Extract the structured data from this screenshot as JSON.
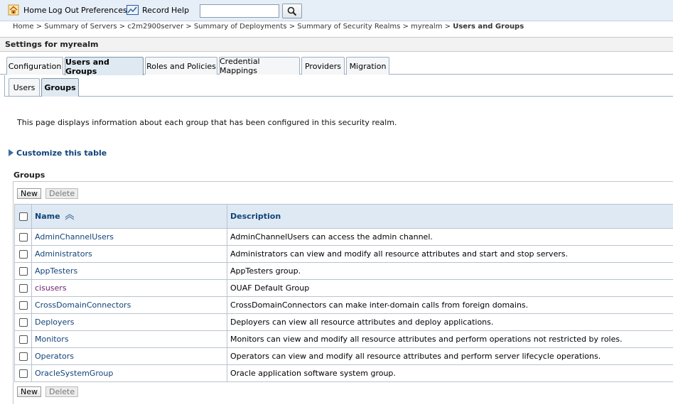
{
  "toolbar": {
    "home": "Home",
    "logout": "Log Out",
    "preferences": "Preferences",
    "record": "Record",
    "help": "Help",
    "search_value": ""
  },
  "breadcrumb": {
    "items": [
      "Home >",
      "Summary of Servers >",
      "c2m2900server >",
      "Summary of Deployments >",
      "Summary of Security Realms >",
      "myrealm >"
    ],
    "current": "Users and Groups"
  },
  "settings": {
    "title": "Settings for myrealm"
  },
  "tabs": [
    "Configuration",
    "Users and Groups",
    "Roles and Policies",
    "Credential Mappings",
    "Providers",
    "Migration"
  ],
  "subtabs": [
    "Users",
    "Groups"
  ],
  "intro": "This page displays information about each group that has been configured in this security realm.",
  "customize": "Customize this table",
  "groups_label": "Groups",
  "buttons": {
    "new": "New",
    "delete": "Delete"
  },
  "table": {
    "columns": {
      "name": "Name",
      "description": "Description"
    },
    "rows": [
      {
        "name": "AdminChannelUsers",
        "description": "AdminChannelUsers can access the admin channel."
      },
      {
        "name": "Administrators",
        "description": "Administrators can view and modify all resource attributes and start and stop servers."
      },
      {
        "name": "AppTesters",
        "description": "AppTesters group."
      },
      {
        "name": "cisusers",
        "description": "OUAF Default Group"
      },
      {
        "name": "CrossDomainConnectors",
        "description": "CrossDomainConnectors can make inter-domain calls from foreign domains."
      },
      {
        "name": "Deployers",
        "description": "Deployers can view all resource attributes and deploy applications."
      },
      {
        "name": "Monitors",
        "description": "Monitors can view and modify all resource attributes and perform operations not restricted by roles."
      },
      {
        "name": "Operators",
        "description": "Operators can view and modify all resource attributes and perform server lifecycle operations."
      },
      {
        "name": "OracleSystemGroup",
        "description": "Oracle application software system group."
      }
    ]
  },
  "colors": {
    "link": "#11447a",
    "visited_link": "#6b1e6e",
    "header_bg": "#dfe9f3",
    "toolbar_bg": "#e6eef7"
  }
}
